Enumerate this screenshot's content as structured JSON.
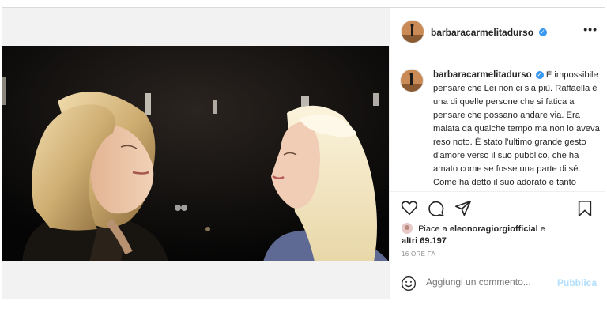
{
  "post": {
    "username": "barbaracarmelitadurso",
    "caption": "È impossibile pensare che Lei non ci sia più. Raffaella è una di quelle persone che si fatica a pensare che possano andare via. Era malata da qualche tempo ma non lo aveva reso noto. È stato l'ultimo grande gesto d'amore verso il suo pubblico, che ha amato come se fosse una parte di sé. Come ha detto il suo adorato e tanto amato",
    "likes_prefix": "Piace a",
    "liked_by": "eleonoragiorgiofficial",
    "likes_conj": "e",
    "likes_rest": "altri 69.197",
    "timestamp": "16 ORE FA",
    "comment_placeholder": "Aggiungi un commento...",
    "publish_label": "Pubblica",
    "more_label": "•••"
  },
  "icons": [
    "verified-badge-icon",
    "more-options-icon",
    "heart-icon",
    "comment-icon",
    "share-icon",
    "bookmark-icon",
    "emoji-icon"
  ],
  "colors": {
    "verified": "#3897f0",
    "publish": "#b2dffc",
    "text": "#262626",
    "muted": "#8e8e8e"
  }
}
